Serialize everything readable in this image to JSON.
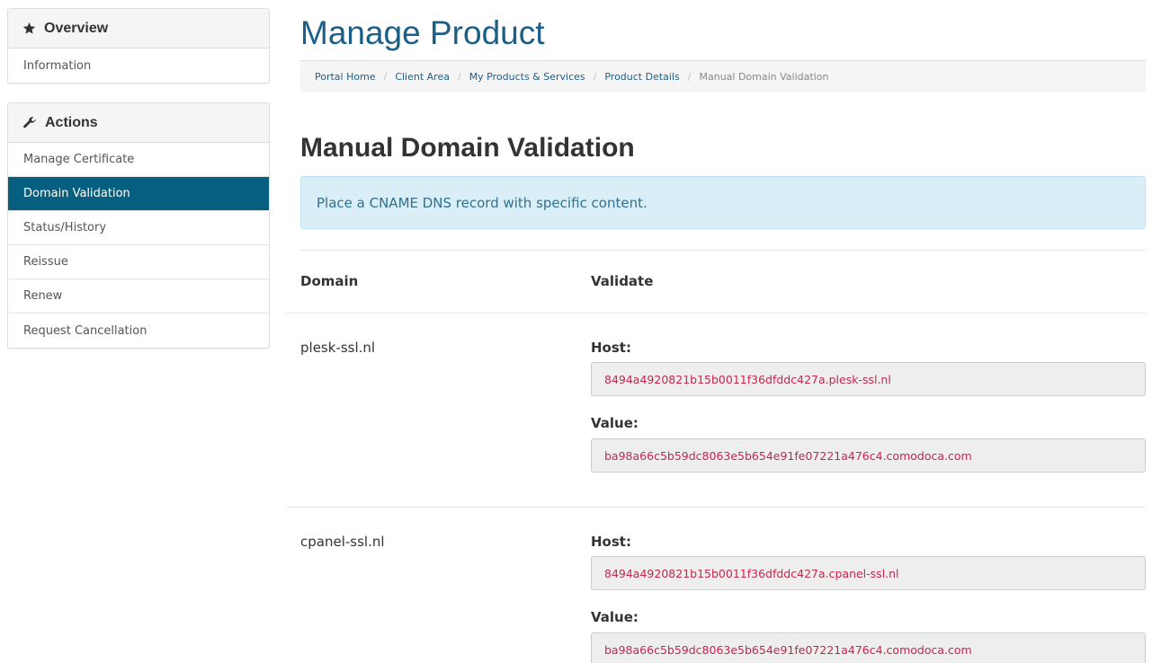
{
  "sidebar": {
    "overview": {
      "title": "Overview",
      "items": [
        {
          "label": "Information"
        }
      ]
    },
    "actions": {
      "title": "Actions",
      "items": [
        {
          "label": "Manage Certificate",
          "active": false
        },
        {
          "label": "Domain Validation",
          "active": true
        },
        {
          "label": "Status/History",
          "active": false
        },
        {
          "label": "Reissue",
          "active": false
        },
        {
          "label": "Renew",
          "active": false
        },
        {
          "label": "Request Cancellation",
          "active": false
        }
      ]
    }
  },
  "page": {
    "title": "Manage Product",
    "breadcrumb": [
      {
        "label": "Portal Home"
      },
      {
        "label": "Client Area"
      },
      {
        "label": "My Products & Services"
      },
      {
        "label": "Product Details"
      },
      {
        "label": "Manual Domain Validation"
      }
    ],
    "section_title": "Manual Domain Validation",
    "alert": "Place a CNAME DNS record with specific content.",
    "table": {
      "headers": [
        "Domain",
        "Validate"
      ],
      "rows": [
        {
          "domain": "plesk-ssl.nl",
          "host_label": "Host:",
          "host": "8494a4920821b15b0011f36dfddc427a.plesk-ssl.nl",
          "value_label": "Value:",
          "value": "ba98a66c5b59dc8063e5b654e91fe07221a476c4.comodoca.com"
        },
        {
          "domain": "cpanel-ssl.nl",
          "host_label": "Host:",
          "host": "8494a4920821b15b0011f36dfddc427a.cpanel-ssl.nl",
          "value_label": "Value:",
          "value": "ba98a66c5b59dc8063e5b654e91fe07221a476c4.comodoca.com"
        }
      ]
    }
  },
  "colors": {
    "accent": "#075f7f",
    "title": "#1b5f88",
    "alert_bg": "#d9eef6",
    "code": "#c7254e"
  }
}
